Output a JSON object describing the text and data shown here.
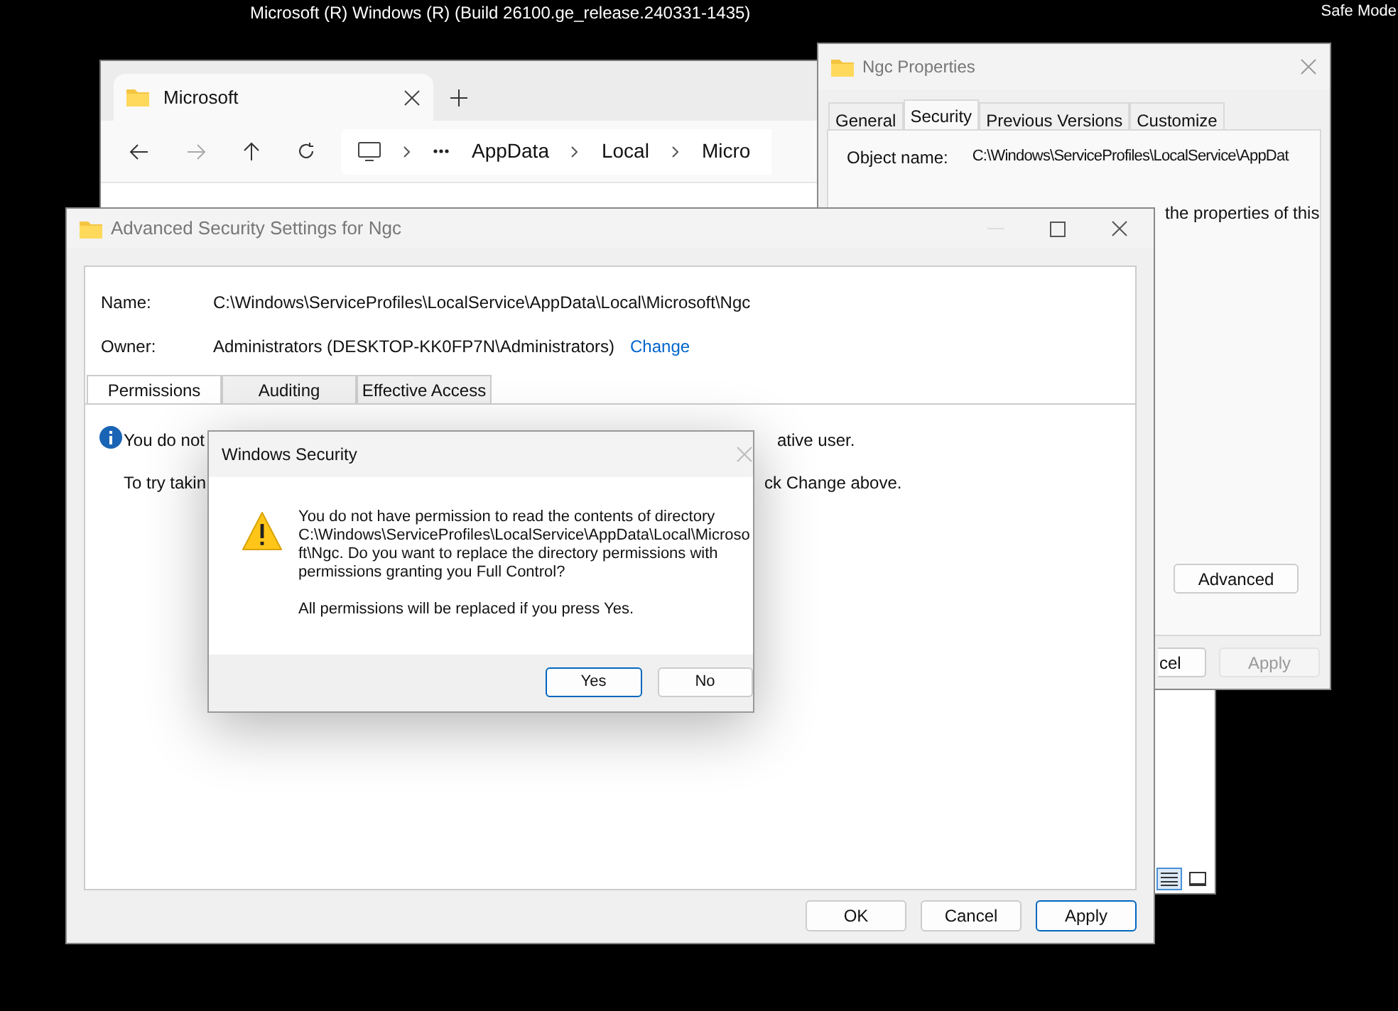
{
  "system_bar": {
    "build": "Microsoft (R) Windows (R) (Build 26100.ge_release.240331-1435)",
    "mode": "Safe Mode"
  },
  "explorer": {
    "tab": {
      "title": "Microsoft",
      "selected": true
    },
    "breadcrumb": [
      "AppData",
      "Local",
      "Micro"
    ],
    "views": [
      {
        "kind": "details",
        "selected": true
      },
      {
        "kind": "tiles",
        "selected": false
      }
    ]
  },
  "ngc_properties": {
    "title": "Ngc Properties",
    "tabs": [
      {
        "label": "General",
        "selected": false
      },
      {
        "label": "Security",
        "selected": true
      },
      {
        "label": "Previous Versions",
        "selected": false
      },
      {
        "label": "Customize",
        "selected": false
      }
    ],
    "object_name_label": "Object name:",
    "object_name": "C:\\Windows\\ServiceProfiles\\LocalService\\AppDat",
    "notice_fragment": "the properties of this",
    "advanced_button": "Advanced",
    "buttons": [
      {
        "label": "cel",
        "disabled": false
      },
      {
        "label": "Apply",
        "disabled": true
      }
    ]
  },
  "advanced_security": {
    "title": "Advanced Security Settings for Ngc",
    "name_label": "Name:",
    "name": "C:\\Windows\\ServiceProfiles\\LocalService\\AppData\\Local\\Microsoft\\Ngc",
    "owner_label": "Owner:",
    "owner": "Administrators (DESKTOP-KK0FP7N\\Administrators)",
    "owner_link": "Change",
    "tabs": [
      {
        "label": "Permissions",
        "selected": true
      },
      {
        "label": "Auditing",
        "selected": false
      },
      {
        "label": "Effective Access",
        "selected": false
      }
    ],
    "notice_fragments": [
      "You do not",
      "ative user.",
      "To try takin",
      "ck Change above."
    ],
    "buttons": [
      {
        "label": "OK",
        "default": false
      },
      {
        "label": "Cancel",
        "default": false
      },
      {
        "label": "Apply",
        "default": true
      }
    ]
  },
  "dialog": {
    "title": "Windows Security",
    "message": "You do not have permission to read the contents of directory C:\\Windows\\ServiceProfiles\\LocalService\\AppData\\Local\\Microsoft\\Ngc. Do you want to replace the directory permissions with permissions granting you Full Control?",
    "note": "All permissions will be replaced if you press Yes.",
    "buttons": [
      {
        "label": "Yes",
        "default": true
      },
      {
        "label": "No",
        "default": false
      }
    ]
  }
}
